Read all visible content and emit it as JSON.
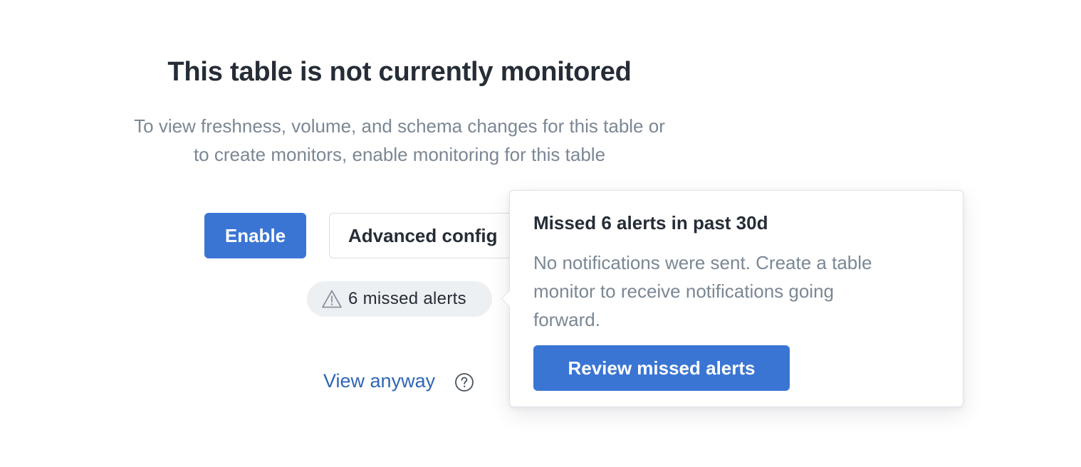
{
  "empty_state": {
    "title": "This table is not currently monitored",
    "subtitle_line1": "To view freshness, volume, and schema changes for this table or",
    "subtitle_line2": "to create monitors, enable monitoring for this table"
  },
  "actions": {
    "enable_label": "Enable",
    "advanced_config_label": "Advanced config",
    "missed_alerts_label": "6 missed alerts",
    "view_anyway_label": "View anyway"
  },
  "popover": {
    "title": "Missed 6 alerts in past 30d",
    "body_line1": "No notifications were sent. Create a table",
    "body_line2": "monitor to receive notifications going",
    "body_line3": "forward.",
    "review_label": "Review missed alerts"
  },
  "colors": {
    "primary": "#3a75d4",
    "link": "#2f65b4",
    "text_dark": "#262d36",
    "text_muted": "#7b8794",
    "pill_bg": "#edf0f3"
  },
  "icons": {
    "missed_alerts": "warning-triangle-icon",
    "help": "question-circle-icon"
  }
}
